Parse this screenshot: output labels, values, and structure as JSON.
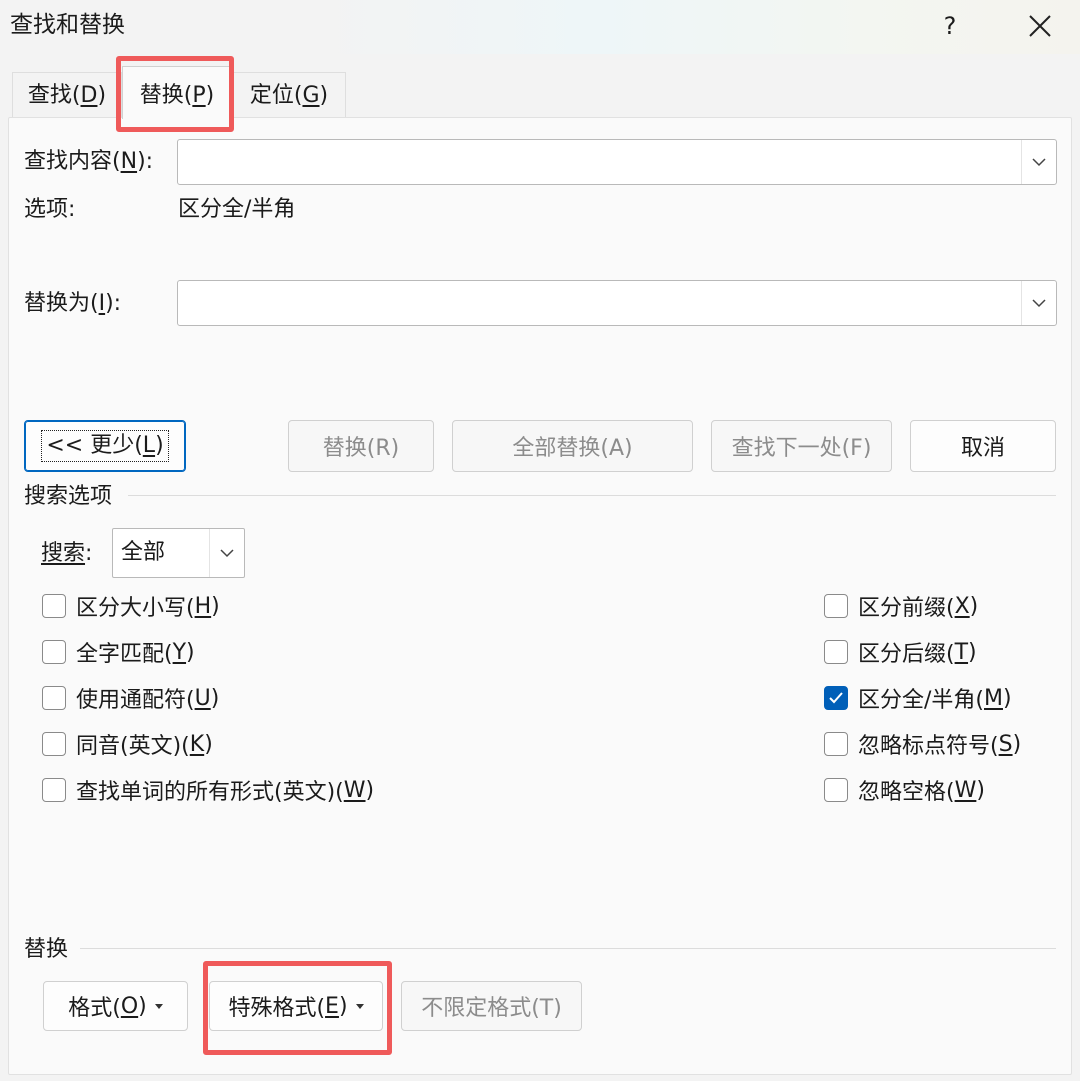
{
  "window": {
    "title": "查找和替换",
    "help": "?"
  },
  "tabs": [
    {
      "text": "查找(",
      "key": "D",
      "end": ")"
    },
    {
      "text": "替换(",
      "key": "P",
      "end": ")"
    },
    {
      "text": "定位(",
      "key": "G",
      "end": ")"
    }
  ],
  "find": {
    "label": "查找内容(",
    "key": "N",
    "end": "):",
    "value": ""
  },
  "options": {
    "label": "选项:",
    "value": "区分全/半角"
  },
  "replace": {
    "label": "替换为(",
    "key": "I",
    "end": "):",
    "value": ""
  },
  "buttons": {
    "less": {
      "text": "<< 更少(",
      "key": "L",
      "end": ")"
    },
    "replace": "替换(R)",
    "replace_all": "全部替换(A)",
    "find_next": "查找下一处(F)",
    "cancel": "取消"
  },
  "search_options": {
    "heading": "搜索选项",
    "search_label": "搜索",
    "search_colon": ":",
    "search_value": "全部",
    "left": [
      {
        "text": "区分大小写(",
        "key": "H",
        "end": ")",
        "checked": false
      },
      {
        "text": "全字匹配(",
        "key": "Y",
        "end": ")",
        "checked": false
      },
      {
        "text": "使用通配符(",
        "key": "U",
        "end": ")",
        "checked": false
      },
      {
        "text": "同音(英文)(",
        "key": "K",
        "end": ")",
        "checked": false
      },
      {
        "text": "查找单词的所有形式(英文)(",
        "key": "W",
        "end": ")",
        "checked": false
      }
    ],
    "right": [
      {
        "text": "区分前缀(",
        "key": "X",
        "end": ")",
        "checked": false
      },
      {
        "text": "区分后缀(",
        "key": "T",
        "end": ")",
        "checked": false
      },
      {
        "text": "区分全/半角(",
        "key": "M",
        "end": ")",
        "checked": true
      },
      {
        "text": "忽略标点符号(",
        "key": "S",
        "end": ")",
        "checked": false
      },
      {
        "text": "忽略空格(",
        "key": "W",
        "end": ")",
        "checked": false
      }
    ]
  },
  "replace_section": {
    "heading": "替换",
    "format": {
      "text": "格式(",
      "key": "O",
      "end": ")"
    },
    "special": {
      "text": "特殊格式(",
      "key": "E",
      "end": ")"
    },
    "no_format": "不限定格式(T)"
  },
  "colors": {
    "highlight": "#ef5a5a",
    "checkbox_on": "#005fb8"
  }
}
